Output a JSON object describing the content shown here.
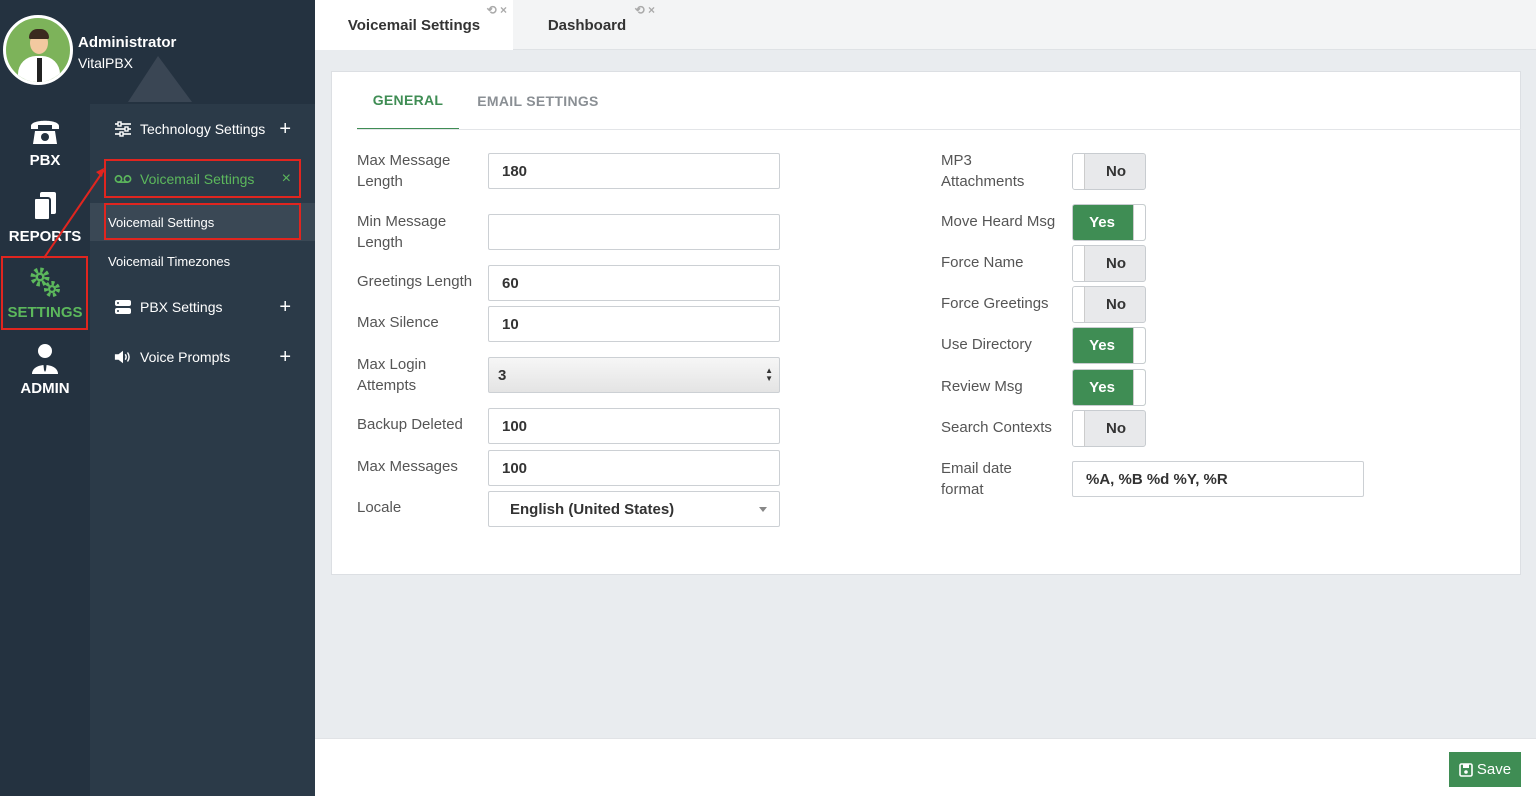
{
  "user": {
    "name": "Administrator",
    "org": "VitalPBX"
  },
  "rail": {
    "pbx": "PBX",
    "reports": "REPORTS",
    "settings": "SETTINGS",
    "admin": "ADMIN"
  },
  "submenu": {
    "technology": "Technology Settings",
    "voicemail": "Voicemail Settings",
    "voicemail_sub": [
      "Voicemail Settings",
      "Voicemail Timezones"
    ],
    "pbx_settings": "PBX Settings",
    "voice_prompts": "Voice Prompts",
    "plus": "+",
    "close": "×"
  },
  "tabs": [
    "Voicemail Settings",
    "Dashboard"
  ],
  "tab_tools": "⟲ ×",
  "card_tabs": {
    "general": "GENERAL",
    "email": "EMAIL SETTINGS"
  },
  "left_fields": {
    "max_message_length": {
      "label": "Max Message Length",
      "value": "180"
    },
    "min_message_length": {
      "label": "Min Message Length",
      "value": ""
    },
    "greetings_length": {
      "label": "Greetings Length",
      "value": "60"
    },
    "max_silence": {
      "label": "Max Silence",
      "value": "10"
    },
    "max_login_attempts": {
      "label": "Max Login Attempts",
      "value": "3"
    },
    "backup_deleted": {
      "label": "Backup Deleted",
      "value": "100"
    },
    "max_messages": {
      "label": "Max Messages",
      "value": "100"
    },
    "locale": {
      "label": "Locale",
      "value": "English (United States)"
    }
  },
  "right_fields": {
    "mp3_attachments": {
      "label": "MP3 Attachments",
      "value": "No"
    },
    "move_heard_msg": {
      "label": "Move Heard Msg",
      "value": "Yes"
    },
    "force_name": {
      "label": "Force Name",
      "value": "No"
    },
    "force_greetings": {
      "label": "Force Greetings",
      "value": "No"
    },
    "use_directory": {
      "label": "Use Directory",
      "value": "Yes"
    },
    "review_msg": {
      "label": "Review Msg",
      "value": "Yes"
    },
    "search_contexts": {
      "label": "Search Contexts",
      "value": "No"
    },
    "email_date_format": {
      "label": "Email date format",
      "value": "%A, %B %d %Y, %R"
    }
  },
  "footer": {
    "save": "Save"
  },
  "colors": {
    "accent": "#3f8d54",
    "sidebar": "#243240",
    "submenu": "#2b3a48",
    "highlight": "#e0251f"
  }
}
